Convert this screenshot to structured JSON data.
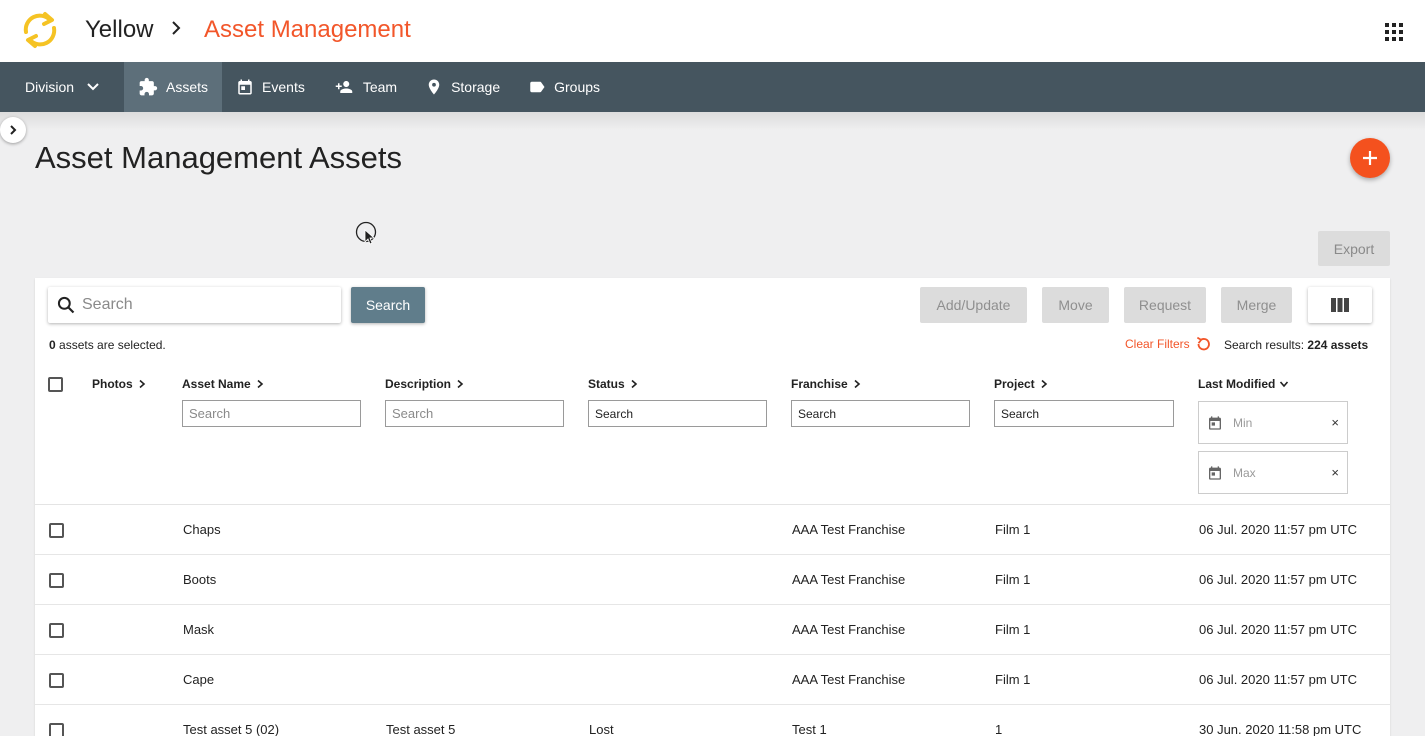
{
  "header": {
    "brand": "Yellow",
    "app_title": "Asset Management"
  },
  "nav": {
    "division_label": "Division",
    "items": [
      {
        "label": "Assets",
        "icon": "puzzle-icon",
        "active": true
      },
      {
        "label": "Events",
        "icon": "calendar-icon"
      },
      {
        "label": "Team",
        "icon": "person-add-icon"
      },
      {
        "label": "Storage",
        "icon": "map-pin-icon"
      },
      {
        "label": "Groups",
        "icon": "label-icon"
      }
    ]
  },
  "page": {
    "title": "Asset Management Assets",
    "export_label": "Export"
  },
  "toolbar": {
    "search_placeholder": "Search",
    "search_button": "Search",
    "add_update": "Add/Update",
    "move": "Move",
    "request": "Request",
    "merge": "Merge"
  },
  "selection": {
    "count": "0",
    "text": "assets are selected."
  },
  "filters": {
    "clear_label": "Clear Filters",
    "results_prefix": "Search results:",
    "results_count": "224 assets"
  },
  "table": {
    "columns": [
      {
        "label": "Photos"
      },
      {
        "label": "Asset Name",
        "filter_placeholder": "Search"
      },
      {
        "label": "Description",
        "filter_placeholder": "Search"
      },
      {
        "label": "Status",
        "filter_placeholder": "Search"
      },
      {
        "label": "Franchise",
        "filter_placeholder": "Search"
      },
      {
        "label": "Project",
        "filter_placeholder": "Search"
      },
      {
        "label": "Last Modified",
        "min_placeholder": "Min",
        "max_placeholder": "Max",
        "clear_glyph": "×"
      }
    ],
    "rows": [
      {
        "name": "Chaps",
        "description": "",
        "status": "",
        "franchise": "AAA Test Franchise",
        "project": "Film 1",
        "modified": "06 Jul. 2020 11:57 pm UTC"
      },
      {
        "name": "Boots",
        "description": "",
        "status": "",
        "franchise": "AAA Test Franchise",
        "project": "Film 1",
        "modified": "06 Jul. 2020 11:57 pm UTC"
      },
      {
        "name": "Mask",
        "description": "",
        "status": "",
        "franchise": "AAA Test Franchise",
        "project": "Film 1",
        "modified": "06 Jul. 2020 11:57 pm UTC"
      },
      {
        "name": "Cape",
        "description": "",
        "status": "",
        "franchise": "AAA Test Franchise",
        "project": "Film 1",
        "modified": "06 Jul. 2020 11:57 pm UTC"
      },
      {
        "name": "Test asset 5 (02)",
        "description": "Test asset 5",
        "status": "Lost",
        "franchise": "Test 1",
        "project": "1",
        "modified": "30 Jun. 2020 11:58 pm UTC"
      }
    ]
  },
  "colors": {
    "accent": "#f2562a",
    "nav_bg": "#45555f",
    "nav_active": "#5d6f7a",
    "fab": "#f4511e",
    "logo": "#f5c324",
    "search_button": "#607d8b"
  }
}
